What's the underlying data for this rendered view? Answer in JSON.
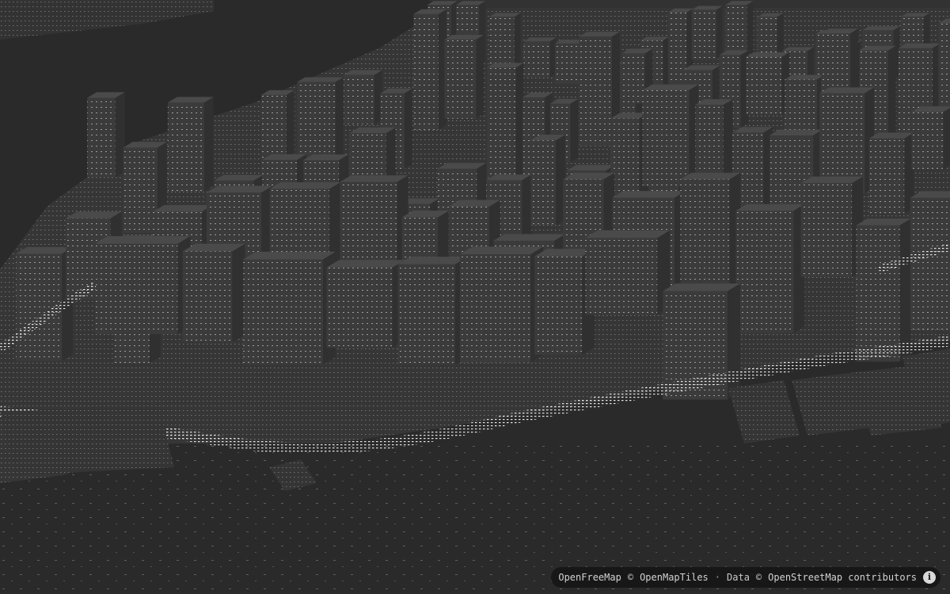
{
  "map": {
    "style": "dark-3d-buildings",
    "colors": {
      "background": "#2b2b2b",
      "building_face": "#3d3d3d",
      "building_roof": "#474747",
      "window_dot": "#bdbdbd",
      "road_dot": "#e6e6e6",
      "water": "#2a2a2a"
    }
  },
  "attribution": {
    "openfreemap": "OpenFreeMap",
    "copyright_sign": "©",
    "openmaptiles": "OpenMapTiles",
    "separator": "·",
    "data_label": "Data",
    "data_copyright": "©",
    "osm": "OpenStreetMap contributors",
    "info_icon": "info-icon"
  }
}
